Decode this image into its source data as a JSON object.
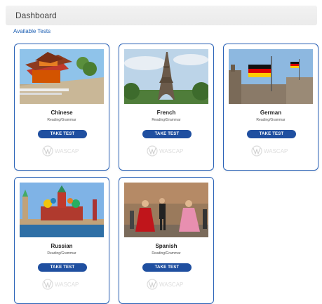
{
  "header": {
    "title": "Dashboard"
  },
  "subheader": {
    "label": "Available Tests"
  },
  "colors": {
    "accent": "#1f4fa0",
    "border": "#2a62b7",
    "link": "#1d5fb3"
  },
  "cards": [
    {
      "language": "Chinese",
      "type": "Reading/Grammar",
      "button": "TAKE TEST",
      "logo": "WASCAP",
      "image": "chinese-pagoda-photo"
    },
    {
      "language": "French",
      "type": "Reading/Grammar",
      "button": "TAKE TEST",
      "logo": "WASCAP",
      "image": "eiffel-tower-photo"
    },
    {
      "language": "German",
      "type": "Reading/Grammar",
      "button": "TAKE TEST",
      "logo": "WASCAP",
      "image": "german-flags-photo"
    },
    {
      "language": "Russian",
      "type": "Reading/Grammar",
      "button": "TAKE TEST",
      "logo": "WASCAP",
      "image": "kremlin-photo"
    },
    {
      "language": "Spanish",
      "type": "Reading/Grammar",
      "button": "TAKE TEST",
      "logo": "WASCAP",
      "image": "flamenco-dancers-photo"
    }
  ]
}
